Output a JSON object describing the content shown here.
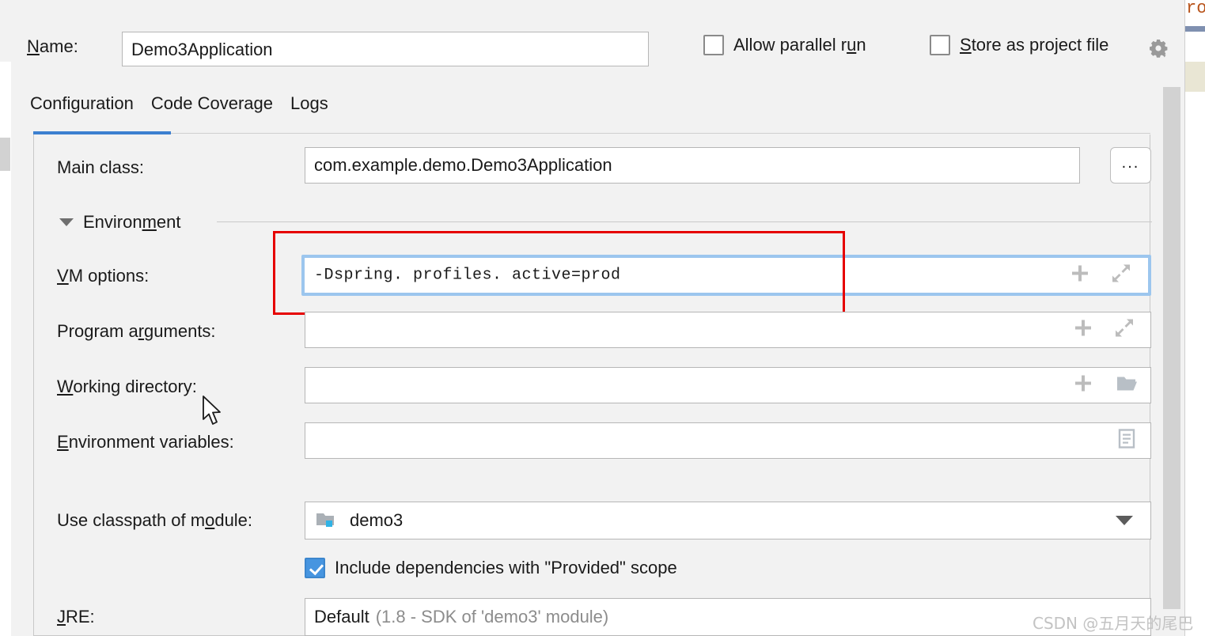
{
  "window": {
    "name_label": "Name:",
    "name_mnemonic": "N",
    "name_value": "Demo3Application"
  },
  "options": {
    "allow_parallel_run": {
      "label_pre": "Allow parallel r",
      "label_mn": "u",
      "label_post": "n",
      "checked": false,
      "icon": "checkbox-icon"
    },
    "store_as_project_file": {
      "label_mn": "S",
      "label_post": "tore as project file",
      "checked": false,
      "icon": "checkbox-icon"
    },
    "gear_icon": "gear-dropdown-icon"
  },
  "tabs": [
    {
      "label": "Configuration",
      "active": true
    },
    {
      "label": "Code Coverage",
      "active": false
    },
    {
      "label": "Logs",
      "active": false
    }
  ],
  "form": {
    "main_class": {
      "label": "Main class:",
      "value": "com.example.demo.Demo3Application",
      "browse_label": "...",
      "browse_icon": "ellipsis-icon"
    },
    "environment_section": {
      "title_pre": "Environ",
      "title_mn": "m",
      "title_post": "ent",
      "expanded": true,
      "collapse_icon": "triangle-down-icon"
    },
    "vm_options": {
      "label_mn": "V",
      "label_post": "M options:",
      "value": "-Dspring. profiles. active=prod",
      "placeholder": "",
      "focused": true,
      "highlighted": true,
      "icons": [
        "plus-icon",
        "expand-icon"
      ]
    },
    "program_arguments": {
      "label_pre": "Program a",
      "label_mn": "r",
      "label_post": "guments:",
      "value": "",
      "icons": [
        "plus-icon",
        "expand-icon"
      ]
    },
    "working_directory": {
      "label_mn": "W",
      "label_post": "orking directory:",
      "value": "",
      "icons": [
        "plus-icon",
        "folder-open-icon"
      ]
    },
    "environment_variables": {
      "label_mn": "E",
      "label_post": "nvironment variables:",
      "value": "",
      "icons": [
        "document-list-icon"
      ]
    },
    "use_classpath_of_module": {
      "label_pre": "Use classpath of m",
      "label_mn": "o",
      "label_post": "dule:",
      "value": "demo3",
      "module_icon": "module-folder-icon",
      "dropdown_icon": "chevron-down-icon"
    },
    "include_provided_scope": {
      "label": "Include dependencies with \"Provided\" scope",
      "checked": true,
      "icon": "checkbox-icon"
    },
    "jre": {
      "label_mn": "J",
      "label_post": "RE:",
      "value_primary": "Default",
      "value_secondary": "(1.8 - SDK of 'demo3' module)"
    }
  },
  "colors": {
    "accent_blue": "#3c80d0",
    "focus_ring": "#9cc6ee",
    "annotation_red": "#e60000",
    "checkbox_checked": "#4795e0",
    "panel_bg": "#f2f2f2",
    "field_bg": "#ffffff"
  },
  "edge": {
    "code_fragment": "ro"
  },
  "watermark": {
    "text": "CSDN @五月天的尾巴"
  }
}
